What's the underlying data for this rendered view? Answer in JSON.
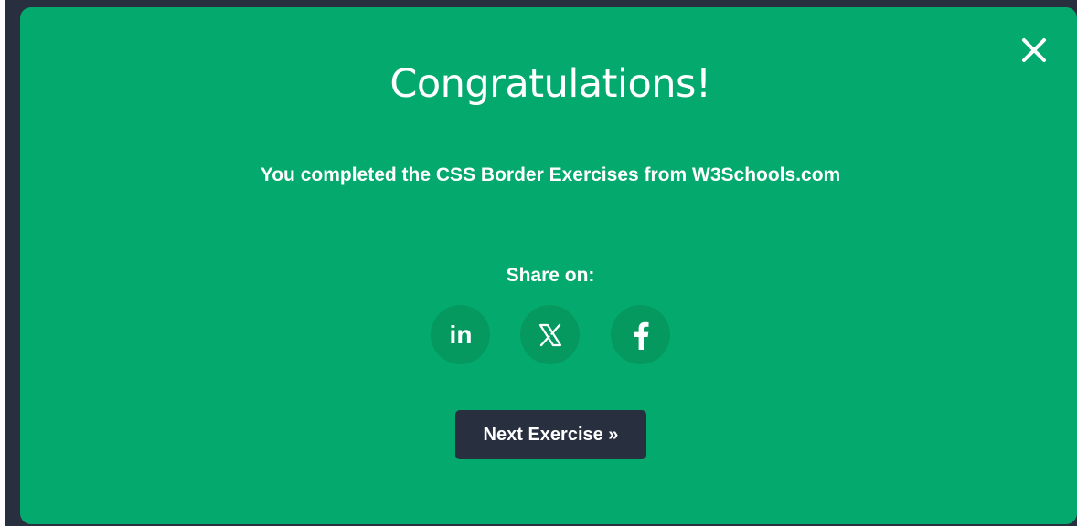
{
  "modal": {
    "title": "Congratulations!",
    "message": "You completed the CSS Border Exercises from W3Schools.com",
    "share_label": "Share on:",
    "share_buttons": [
      {
        "icon": "linkedin-icon",
        "glyph": "in"
      },
      {
        "icon": "x-icon"
      },
      {
        "icon": "facebook-icon"
      }
    ],
    "next_label": "Next Exercise »",
    "close_icon": "close-icon"
  },
  "colors": {
    "modal_background": "#04aa6d",
    "share_button_background": "#06995f",
    "next_button_background": "#282f3f",
    "backdrop": "#282f3f",
    "text": "#ffffff"
  }
}
